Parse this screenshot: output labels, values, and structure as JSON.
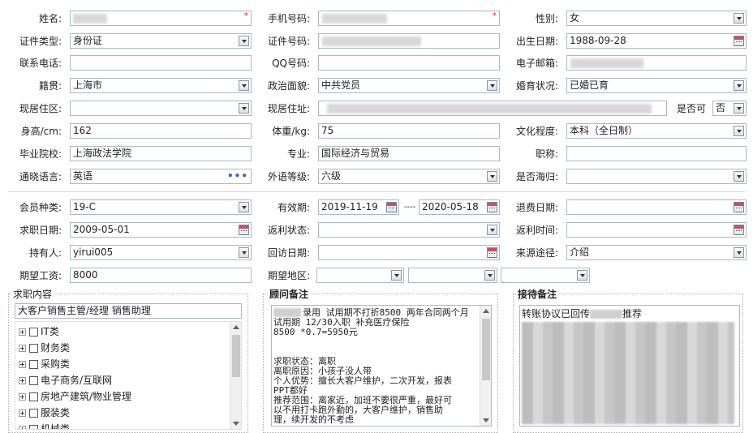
{
  "labels": {
    "name": "姓名:",
    "mobile": "手机号码:",
    "gender": "性别:",
    "id_type": "证件类型:",
    "id_no": "证件号码:",
    "birth_date": "出生日期:",
    "phone": "联系电话:",
    "qq": "QQ号码:",
    "email": "电子邮箱:",
    "hometown": "籍贯:",
    "political": "政治面貌:",
    "marital": "婚育状况:",
    "residence_area": "现居住区:",
    "residence_addr": "现居住址:",
    "can_it": "是否可",
    "height": "身高/cm:",
    "weight": "体重/kg:",
    "education": "文化程度:",
    "school": "毕业院校:",
    "major": "专业:",
    "title": "职称:",
    "languages": "通晓语言:",
    "lang_level": "外语等级:",
    "overseas": "是否海归:",
    "member_type": "会员种类:",
    "validity": "有效期:",
    "refund_date": "退费日期:",
    "apply_date": "求职日期:",
    "rebate_status": "返利状态:",
    "rebate_time": "返利时间:",
    "holder": "持有人:",
    "visit_date": "回访日期:",
    "source": "来源途径:",
    "salary": "期望工资:",
    "area": "期望地区:"
  },
  "values": {
    "name_req": "*",
    "mobile_req": "*",
    "gender": "女",
    "id_type": "身份证",
    "birth_date": "1988-09-28",
    "hometown": "上海市",
    "political": "中共党员",
    "marital": "已婚已育",
    "can_it": "否",
    "height": "162",
    "weight": "75",
    "education": "本科（全日制）",
    "school": "上海政法学院",
    "major": "国际经济与贸易",
    "languages": "英语",
    "more": "•••",
    "lang_level": "六级",
    "member_type": "19-C",
    "valid_from": "2019-11-19",
    "valid_sep": "----",
    "valid_to": "2020-05-18",
    "apply_date": "2009-05-01",
    "holder": "yirui005",
    "source": "介绍",
    "salary": "8000"
  },
  "job_panel": {
    "title": "求职内容",
    "content": "大客户销售主管/经理 销售助理",
    "tree": [
      "IT类",
      "财务类",
      "采购类",
      "电子商务/互联网",
      "房地产建筑/物业管理",
      "服装类",
      "机械类"
    ]
  },
  "advisor_panel": {
    "title": "顾问备注",
    "lines": [
      "录用  试用期不打折8500 两年合同两个月",
      "试用期 12/30入职 补充医疗保险",
      "8500 *0.7=5950元",
      "",
      "",
      "求职状态：离职",
      "离职原因：小孩子没人带",
      "个人优势：擅长大客户维护，二次开发，报表",
      "PPT都好",
      "推荐范围：离家近，加班不要很严重，最好可",
      "以不用打卡跑外勤的，大客户维护，销售助",
      "理，续开发的不考虑"
    ]
  },
  "reception_panel": {
    "title": "接待备注",
    "line1_a": "转账协议已回传",
    "line1_b": "推荐"
  },
  "colors": {
    "border": "#a9b8c8",
    "required": "#e03030",
    "more": "#3366cc"
  }
}
